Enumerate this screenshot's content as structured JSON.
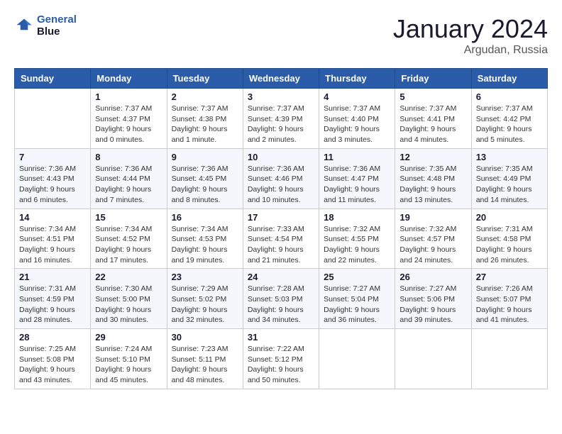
{
  "logo": {
    "line1": "General",
    "line2": "Blue"
  },
  "title": "January 2024",
  "location": "Argudan, Russia",
  "header_days": [
    "Sunday",
    "Monday",
    "Tuesday",
    "Wednesday",
    "Thursday",
    "Friday",
    "Saturday"
  ],
  "weeks": [
    [
      {
        "day": "",
        "info": ""
      },
      {
        "day": "1",
        "info": "Sunrise: 7:37 AM\nSunset: 4:37 PM\nDaylight: 9 hours\nand 0 minutes."
      },
      {
        "day": "2",
        "info": "Sunrise: 7:37 AM\nSunset: 4:38 PM\nDaylight: 9 hours\nand 1 minute."
      },
      {
        "day": "3",
        "info": "Sunrise: 7:37 AM\nSunset: 4:39 PM\nDaylight: 9 hours\nand 2 minutes."
      },
      {
        "day": "4",
        "info": "Sunrise: 7:37 AM\nSunset: 4:40 PM\nDaylight: 9 hours\nand 3 minutes."
      },
      {
        "day": "5",
        "info": "Sunrise: 7:37 AM\nSunset: 4:41 PM\nDaylight: 9 hours\nand 4 minutes."
      },
      {
        "day": "6",
        "info": "Sunrise: 7:37 AM\nSunset: 4:42 PM\nDaylight: 9 hours\nand 5 minutes."
      }
    ],
    [
      {
        "day": "7",
        "info": "Sunrise: 7:36 AM\nSunset: 4:43 PM\nDaylight: 9 hours\nand 6 minutes."
      },
      {
        "day": "8",
        "info": "Sunrise: 7:36 AM\nSunset: 4:44 PM\nDaylight: 9 hours\nand 7 minutes."
      },
      {
        "day": "9",
        "info": "Sunrise: 7:36 AM\nSunset: 4:45 PM\nDaylight: 9 hours\nand 8 minutes."
      },
      {
        "day": "10",
        "info": "Sunrise: 7:36 AM\nSunset: 4:46 PM\nDaylight: 9 hours\nand 10 minutes."
      },
      {
        "day": "11",
        "info": "Sunrise: 7:36 AM\nSunset: 4:47 PM\nDaylight: 9 hours\nand 11 minutes."
      },
      {
        "day": "12",
        "info": "Sunrise: 7:35 AM\nSunset: 4:48 PM\nDaylight: 9 hours\nand 13 minutes."
      },
      {
        "day": "13",
        "info": "Sunrise: 7:35 AM\nSunset: 4:49 PM\nDaylight: 9 hours\nand 14 minutes."
      }
    ],
    [
      {
        "day": "14",
        "info": "Sunrise: 7:34 AM\nSunset: 4:51 PM\nDaylight: 9 hours\nand 16 minutes."
      },
      {
        "day": "15",
        "info": "Sunrise: 7:34 AM\nSunset: 4:52 PM\nDaylight: 9 hours\nand 17 minutes."
      },
      {
        "day": "16",
        "info": "Sunrise: 7:34 AM\nSunset: 4:53 PM\nDaylight: 9 hours\nand 19 minutes."
      },
      {
        "day": "17",
        "info": "Sunrise: 7:33 AM\nSunset: 4:54 PM\nDaylight: 9 hours\nand 21 minutes."
      },
      {
        "day": "18",
        "info": "Sunrise: 7:32 AM\nSunset: 4:55 PM\nDaylight: 9 hours\nand 22 minutes."
      },
      {
        "day": "19",
        "info": "Sunrise: 7:32 AM\nSunset: 4:57 PM\nDaylight: 9 hours\nand 24 minutes."
      },
      {
        "day": "20",
        "info": "Sunrise: 7:31 AM\nSunset: 4:58 PM\nDaylight: 9 hours\nand 26 minutes."
      }
    ],
    [
      {
        "day": "21",
        "info": "Sunrise: 7:31 AM\nSunset: 4:59 PM\nDaylight: 9 hours\nand 28 minutes."
      },
      {
        "day": "22",
        "info": "Sunrise: 7:30 AM\nSunset: 5:00 PM\nDaylight: 9 hours\nand 30 minutes."
      },
      {
        "day": "23",
        "info": "Sunrise: 7:29 AM\nSunset: 5:02 PM\nDaylight: 9 hours\nand 32 minutes."
      },
      {
        "day": "24",
        "info": "Sunrise: 7:28 AM\nSunset: 5:03 PM\nDaylight: 9 hours\nand 34 minutes."
      },
      {
        "day": "25",
        "info": "Sunrise: 7:27 AM\nSunset: 5:04 PM\nDaylight: 9 hours\nand 36 minutes."
      },
      {
        "day": "26",
        "info": "Sunrise: 7:27 AM\nSunset: 5:06 PM\nDaylight: 9 hours\nand 39 minutes."
      },
      {
        "day": "27",
        "info": "Sunrise: 7:26 AM\nSunset: 5:07 PM\nDaylight: 9 hours\nand 41 minutes."
      }
    ],
    [
      {
        "day": "28",
        "info": "Sunrise: 7:25 AM\nSunset: 5:08 PM\nDaylight: 9 hours\nand 43 minutes."
      },
      {
        "day": "29",
        "info": "Sunrise: 7:24 AM\nSunset: 5:10 PM\nDaylight: 9 hours\nand 45 minutes."
      },
      {
        "day": "30",
        "info": "Sunrise: 7:23 AM\nSunset: 5:11 PM\nDaylight: 9 hours\nand 48 minutes."
      },
      {
        "day": "31",
        "info": "Sunrise: 7:22 AM\nSunset: 5:12 PM\nDaylight: 9 hours\nand 50 minutes."
      },
      {
        "day": "",
        "info": ""
      },
      {
        "day": "",
        "info": ""
      },
      {
        "day": "",
        "info": ""
      }
    ]
  ]
}
